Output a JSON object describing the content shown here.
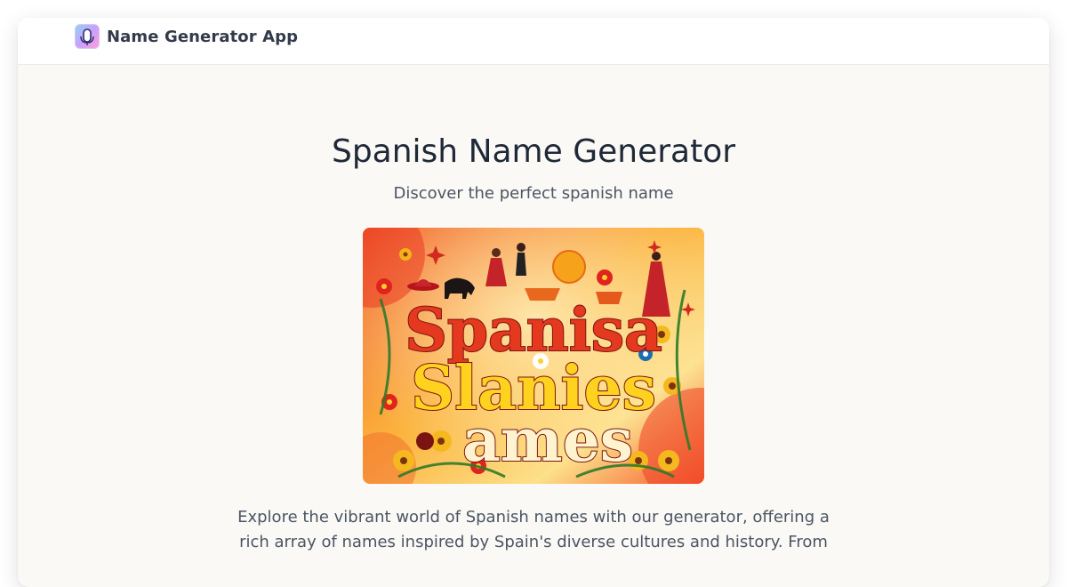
{
  "app": {
    "brand_name": "Name Generator App",
    "logo_icon": "microphone-app-icon"
  },
  "hero": {
    "title": "Spanish Name Generator",
    "subtitle": "Discover the perfect spanish name",
    "image_words": [
      "Spanisa",
      "Slanies",
      "ames"
    ]
  },
  "content": {
    "description": "Explore the vibrant world of Spanish names with our generator, offering a rich array of names inspired by Spain's diverse cultures and history. From"
  },
  "colors": {
    "page_bg": "#faf9f6",
    "navbar_bg": "#ffffff",
    "title_text": "#1f2937",
    "body_text": "#4b5563",
    "poster_red": "#e8402a",
    "poster_yellow": "#ffd21f"
  }
}
